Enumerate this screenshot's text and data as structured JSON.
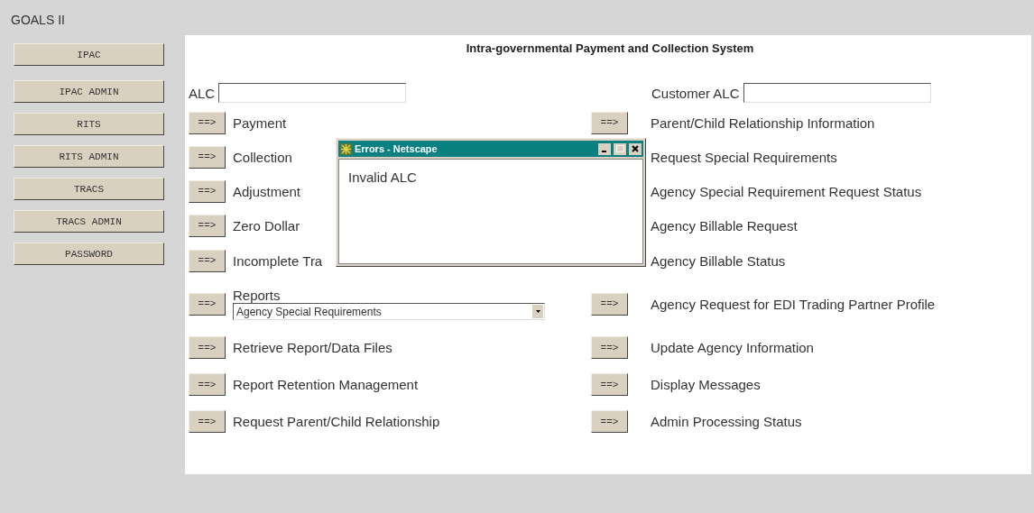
{
  "app_title": "GOALS II",
  "nav": [
    "IPAC",
    "IPAC ADMIN",
    "RITS",
    "RITS ADMIN",
    "TRACS",
    "TRACS ADMIN",
    "PASSWORD"
  ],
  "panel": {
    "title": "Intra-governmental Payment and Collection System",
    "alc": {
      "label": "ALC"
    },
    "customer_alc": {
      "label": "Customer ALC"
    },
    "left_actions": [
      {
        "kind": "link",
        "button": "==>",
        "label": "Payment"
      },
      {
        "kind": "link",
        "button": "==>",
        "label": "Collection"
      },
      {
        "kind": "link",
        "button": "==>",
        "label": "Adjustment"
      },
      {
        "kind": "link",
        "button": "==>",
        "label": "Zero Dollar"
      },
      {
        "kind": "link",
        "button": "==>",
        "label": "Incomplete Tra"
      },
      {
        "kind": "select",
        "button": "==>",
        "label": "Reports",
        "value": "Agency Special Requirements"
      },
      {
        "kind": "link",
        "button": "==>",
        "label": "Retrieve Report/Data Files"
      },
      {
        "kind": "link",
        "button": "==>",
        "label": "Report Retention Management"
      },
      {
        "kind": "link",
        "button": "==>",
        "label": "Request Parent/Child Relationship"
      }
    ],
    "right_actions": [
      {
        "kind": "link",
        "button": "==>",
        "label": "Parent/Child Relationship Information"
      },
      {
        "kind": "link",
        "label": "Request Special Requirements"
      },
      {
        "kind": "link",
        "label": "Agency Special Requirement Request Status"
      },
      {
        "kind": "link",
        "label": "Agency Billable Request"
      },
      {
        "kind": "link",
        "label": "Agency Billable Status"
      },
      {
        "kind": "link",
        "button": "==>",
        "label": "Agency Request for EDI Trading Partner Profile"
      },
      {
        "kind": "link",
        "button": "==>",
        "label": "Update Agency Information"
      },
      {
        "kind": "link",
        "button": "==>",
        "label": "Display Messages"
      },
      {
        "kind": "link",
        "button": "==>",
        "label": "Admin Processing Status"
      }
    ]
  },
  "dialog": {
    "title": "Errors - Netscape",
    "message": "Invalid ALC"
  }
}
